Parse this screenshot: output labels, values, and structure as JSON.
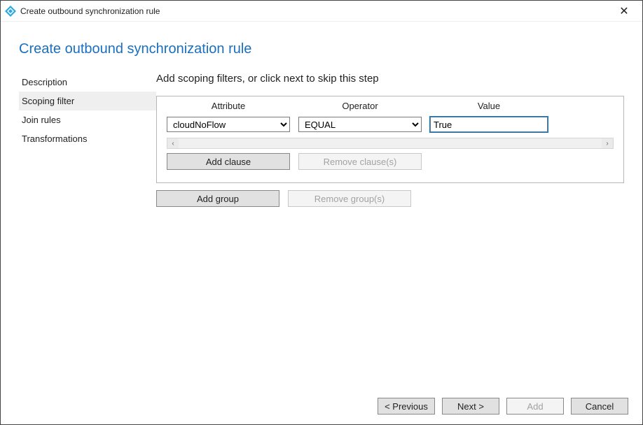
{
  "titlebar": {
    "text": "Create outbound synchronization rule",
    "close_glyph": "✕"
  },
  "heading": "Create outbound synchronization rule",
  "sidebar": {
    "items": [
      {
        "label": "Description",
        "active": false
      },
      {
        "label": "Scoping filter",
        "active": true
      },
      {
        "label": "Join rules",
        "active": false
      },
      {
        "label": "Transformations",
        "active": false
      }
    ]
  },
  "main": {
    "step_title": "Add scoping filters, or click next to skip this step",
    "columns": {
      "attribute": "Attribute",
      "operator": "Operator",
      "value": "Value"
    },
    "row": {
      "attribute_selected": "cloudNoFlow",
      "operator_selected": "EQUAL",
      "value": "True"
    },
    "scroll": {
      "left": "‹",
      "right": "›"
    },
    "buttons": {
      "add_clause": "Add clause",
      "remove_clause": "Remove clause(s)",
      "add_group": "Add group",
      "remove_group": "Remove group(s)"
    }
  },
  "footer": {
    "previous": "< Previous",
    "next": "Next >",
    "add": "Add",
    "cancel": "Cancel"
  }
}
